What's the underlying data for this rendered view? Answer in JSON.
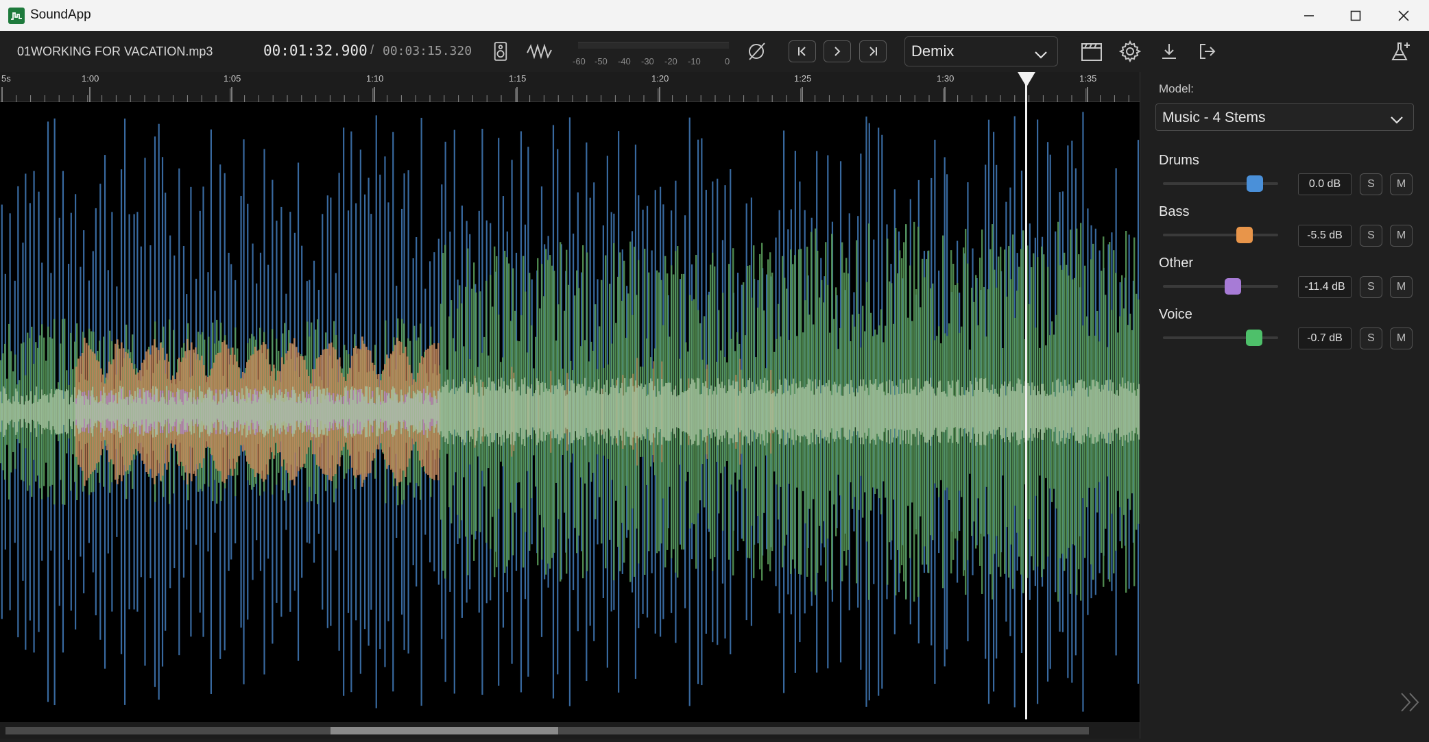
{
  "window": {
    "title": "SoundApp"
  },
  "toolbar": {
    "filename": "01WORKING FOR VACATION.mp3",
    "current_time": "00:01:32.900",
    "separator": "/",
    "total_time": "00:03:15.320",
    "meter_ticks": [
      "-60",
      "-50",
      "-40",
      "-30",
      "-20",
      "-10",
      "0"
    ],
    "mode": "Demix"
  },
  "timeline": {
    "labels": [
      "5s",
      "1:00",
      "1:05",
      "1:10",
      "1:15",
      "1:20",
      "1:25",
      "1:30",
      "1:35"
    ],
    "playhead_time": "1:32.900",
    "scroll_position_fraction": 0.3,
    "scroll_view_fraction": 0.21
  },
  "panel": {
    "model_label": "Model:",
    "model_value": "Music - 4 Stems",
    "stems": [
      {
        "name": "Drums",
        "db": "0.0 dB",
        "level": 0.8,
        "color": "#4a90d9",
        "solo": "S",
        "mute": "M"
      },
      {
        "name": "Bass",
        "db": "-5.5 dB",
        "level": 0.71,
        "color": "#e8954a",
        "solo": "S",
        "mute": "M"
      },
      {
        "name": "Other",
        "db": "-11.4 dB",
        "level": 0.61,
        "color": "#a77bd6",
        "solo": "S",
        "mute": "M"
      },
      {
        "name": "Voice",
        "db": "-0.7 dB",
        "level": 0.79,
        "color": "#4ec06a",
        "solo": "S",
        "mute": "M"
      }
    ]
  },
  "colors": {
    "drums": "#3b6fa8",
    "bass": "#c8895a",
    "other": "#b685c9",
    "voice": "#5a9e5a",
    "mix": "#a8c4a0"
  }
}
